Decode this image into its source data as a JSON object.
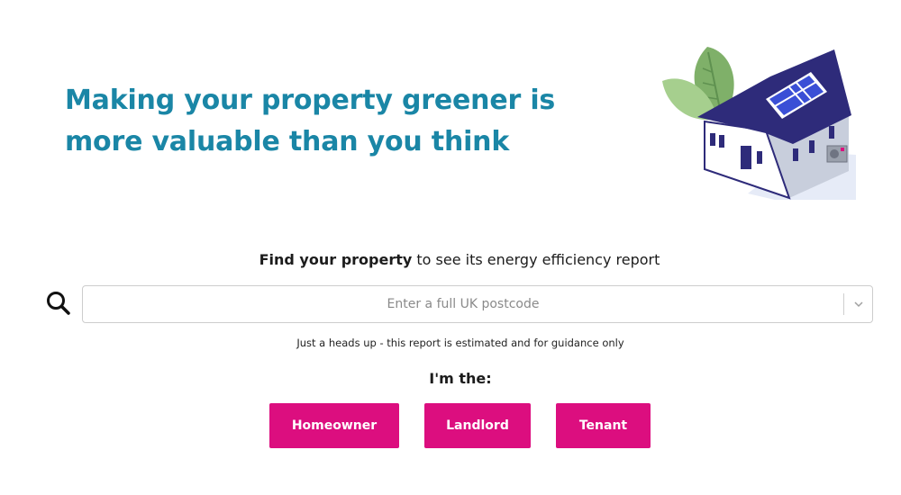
{
  "hero": {
    "heading": "Making your property greener is more valuable than you think"
  },
  "search": {
    "prompt_strong": "Find your property",
    "prompt_rest": " to see its energy efficiency report",
    "placeholder": "Enter a full UK postcode",
    "value": "",
    "disclaimer": "Just a heads up - this report is estimated and for guidance only"
  },
  "roles": {
    "label": "I'm the:",
    "buttons": [
      "Homeowner",
      "Landlord",
      "Tenant"
    ]
  },
  "colors": {
    "heading": "#1a86a6",
    "button_bg": "#dc0e7f",
    "button_text": "#ffffff"
  },
  "icons": {
    "search": "search-icon",
    "dropdown": "chevron-down-icon",
    "illustration": "green-house-illustration"
  }
}
